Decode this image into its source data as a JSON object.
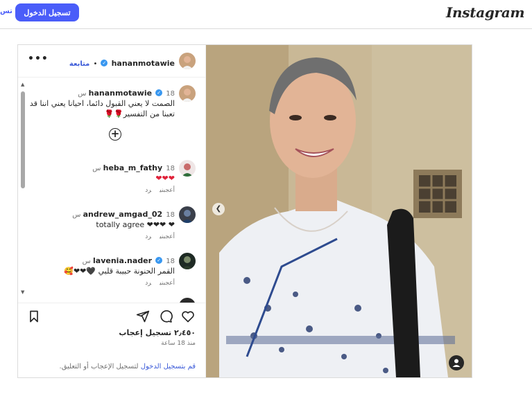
{
  "header": {
    "logo": "Instagram",
    "login_label": "تسجيل الدخول",
    "signup_label": "تس"
  },
  "post": {
    "author": "hananmotawie",
    "follow_label": "متابعة",
    "dot": "•",
    "more": "•••",
    "caption": {
      "time": "18 س",
      "text": "الصمت لا يعني القبول دائما، احيانا يعني اننا قد تعبنا من التفسير🌹🌹"
    },
    "comments": [
      {
        "user": "heba_m_fathy",
        "time": "18 س",
        "text": "❤❤❤",
        "like_label": "أعجبني",
        "reply_label": "رد"
      },
      {
        "user": "andrew_amgad_02",
        "time": "18 س",
        "text": "totally agree ❤❤❤ ❤",
        "like_label": "أعجبني",
        "reply_label": "رد"
      },
      {
        "user": "lavenia.nader",
        "time": "18 س",
        "text": "القمر الحنونة حبيبة قلبي 🖤❤❤🥰",
        "like_label": "أعجبني",
        "reply_label": "رد"
      }
    ],
    "likes": "٢٫٤٥٠ تسجيل إعجاب",
    "posted_ago": "منذ 18 ساعة",
    "login_prompt_link": "قم بتسجيل الدخول",
    "login_prompt_rest": " لتسجيل الإعجاب أو التعليق."
  },
  "icons": [
    "heart-icon",
    "comment-icon",
    "share-icon",
    "bookmark-icon",
    "plus-circle-icon",
    "verified-icon",
    "more-icon",
    "chevron-left-icon",
    "user-tag-icon"
  ],
  "colors": {
    "accent": "#4a5df9",
    "link": "#3b5ad8",
    "verified": "#3897f0"
  }
}
